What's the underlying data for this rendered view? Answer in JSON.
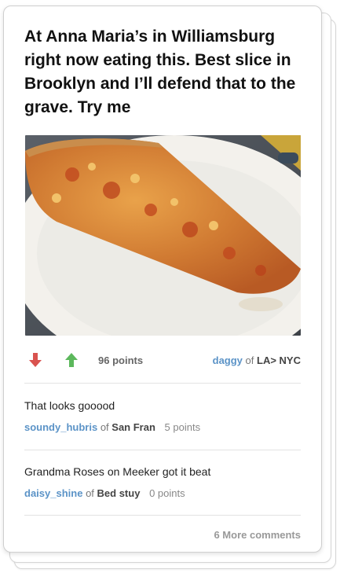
{
  "post": {
    "title": "At Anna Maria’s in Williamsburg right now eating this.  Best slice in Brooklyn and I’ll defend that to the grave.  Try me",
    "photo_icon": "pizza-slice-photo",
    "points": "96 points",
    "author": {
      "username": "daggy",
      "of": "of",
      "location": "LA> NYC"
    }
  },
  "icons": {
    "downvote": "arrow-down-icon",
    "upvote": "arrow-up-icon"
  },
  "colors": {
    "downvote": "#d9534f",
    "upvote": "#5cb85c",
    "username": "#5b93c7"
  },
  "comments": [
    {
      "text": "That looks gooood",
      "username": "soundy_hubris",
      "of": "of",
      "location": "San Fran",
      "points": "5 points"
    },
    {
      "text": "Grandma Roses on Meeker got it beat",
      "username": "daisy_shine",
      "of": "of",
      "location": "Bed stuy",
      "points": "0 points"
    }
  ],
  "more_comments": "6 More comments"
}
